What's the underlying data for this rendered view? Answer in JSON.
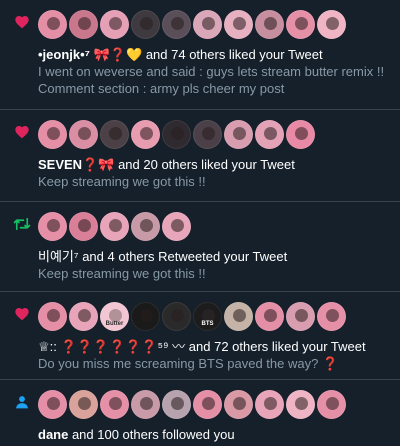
{
  "notifications": [
    {
      "type": "like",
      "icon": "heart-icon",
      "icon_color": "#e0245e",
      "avatar_colors": [
        "#e58fa6",
        "#c9778c",
        "#e6a0b5",
        "#3f3a3f",
        "#5a4e58",
        "#d9a7b8",
        "#e7b0c0",
        "#c78e9f",
        "#e690a8",
        "#f0b5c5"
      ],
      "name": "•jeonjk•⁷ 🎀❓💛",
      "rest": " and 74 others liked your Tweet",
      "text_lines": [
        "I went on weverse and said : guys lets stream butter remix !!",
        "Comment section : army pls cheer my post"
      ]
    },
    {
      "type": "like",
      "icon": "heart-icon",
      "icon_color": "#e0245e",
      "avatar_colors": [
        "#e58fa6",
        "#d98ea3",
        "#4a4045",
        "#e89cb0",
        "#2f2a30",
        "#4b3f48",
        "#d99db0",
        "#e3a2b6",
        "#e88aa5"
      ],
      "name": "SEVEN❓🎀",
      "rest": " and 20 others liked your Tweet",
      "text_lines": [
        "Keep streaming we got this !!"
      ]
    },
    {
      "type": "retweet",
      "icon": "retweet-icon",
      "icon_color": "#17bf63",
      "avatar_colors": [
        "#e690a8",
        "#d97f98",
        "#e8a4b8",
        "#c79aa7",
        "#e7a6b9"
      ],
      "name": "비예기⁷",
      "rest": " and 4 others Retweeted your Tweet",
      "text_lines": [
        "Keep streaming we got this !!"
      ]
    },
    {
      "type": "like",
      "icon": "heart-icon",
      "icon_color": "#e0245e",
      "avatar_colors": [
        "#e58fa6",
        "#e8a4b8",
        "#f2c6d2",
        "#1a1a1a",
        "#2a2a2a",
        "#1c1c1c",
        "#c4b3a6",
        "#e58fa6",
        "#d99db0",
        "#e690a8"
      ],
      "avatar_badges": [
        "",
        "",
        "Butter",
        "",
        "",
        "BTS",
        "",
        "",
        "",
        ""
      ],
      "name": "♕:: ❓❓❓❓❓❓",
      "rest": "⁵⁹ 〰 and 72 others liked your Tweet",
      "text_lines": [
        "Do you miss me screaming BTS paved the way? ❓"
      ]
    },
    {
      "type": "follow",
      "icon": "person-icon",
      "icon_color": "#1da1f2",
      "avatar_colors": [
        "#e58fa6",
        "#d9a29a",
        "#e690a8",
        "#c99aa8",
        "#b7a3ae",
        "#e58fa6",
        "#d99aa5",
        "#e8a4b8",
        "#f0b5c5",
        "#e690a8"
      ],
      "name": "dane",
      "rest": " and 100 others followed you",
      "text_lines": []
    }
  ]
}
